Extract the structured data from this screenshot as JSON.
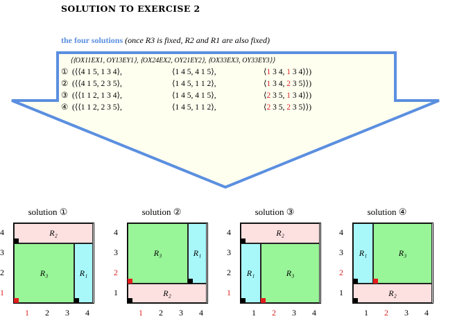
{
  "title": "SOLUTION TO EXERCISE 2",
  "subtitle": {
    "bold": "the four solutions",
    "italic": "(once R3 is fixed, R2 and R1 are also fixed)"
  },
  "header": "⟨⟨OX11EX1, OY13EY1⟩, ⟨OX24EX2, OY21EY2⟩, ⟨OX33EX3, OY33EY3⟩⟩",
  "rows": [
    {
      "num": "①",
      "r1": "(⟨⟨4 1 5, 1 3 4⟩,",
      "r2": "⟨1 4 5, 4 1 5⟩,",
      "r3a": "1",
      "r3b": " 3 4, ",
      "r3c": "1",
      "r3d": " 3 4⟩⟩)"
    },
    {
      "num": "②",
      "r1": "(⟨⟨4 1 5, 2 3 5⟩,",
      "r2": "⟨1 4 5, 1 1 2⟩,",
      "r3a": "1",
      "r3b": " 3 4, ",
      "r3c": "2",
      "r3d": " 3 5⟩⟩)"
    },
    {
      "num": "③",
      "r1": "(⟨⟨1 1 2, 1 3 4⟩,",
      "r2": "⟨1 4 5, 4 1 5⟩,",
      "r3a": "2",
      "r3b": " 3 5, ",
      "r3c": "1",
      "r3d": " 3 4⟩⟩)"
    },
    {
      "num": "④",
      "r1": "(⟨⟨1 1 2, 2 3 5⟩,",
      "r2": "⟨1 4 5, 1 1 2⟩,",
      "r3a": "2",
      "r3b": " 3 5, ",
      "r3c": "2",
      "r3d": " 3 5⟩⟩)"
    }
  ],
  "solutions": [
    {
      "title": "solution ①",
      "ylabels": [
        "4",
        "3",
        "2",
        "1"
      ],
      "xlabels": [
        "1",
        "2",
        "3",
        "4"
      ],
      "ylabel_red": "1",
      "xlabel_red": "1",
      "rects": [
        {
          "label": "R₂"
        },
        {
          "label": "R₃"
        },
        {
          "label": "R₁"
        }
      ]
    },
    {
      "title": "solution ②",
      "ylabels": [
        "4",
        "3",
        "2",
        "1"
      ],
      "xlabels": [
        "1",
        "2",
        "3",
        "4"
      ],
      "ylabel_red": "2",
      "xlabel_red": "1",
      "rects": [
        {
          "label": "R₃"
        },
        {
          "label": "R₁"
        },
        {
          "label": "R₂"
        }
      ]
    },
    {
      "title": "solution ③",
      "ylabels": [
        "4",
        "3",
        "2",
        "1"
      ],
      "xlabels": [
        "1",
        "2",
        "3",
        "4"
      ],
      "ylabel_red": "1",
      "xlabel_red": "2",
      "rects": [
        {
          "label": "R₂"
        },
        {
          "label": "R₁"
        },
        {
          "label": "R₃"
        }
      ]
    },
    {
      "title": "solution ④",
      "ylabels": [
        "4",
        "3",
        "2",
        "1"
      ],
      "xlabels": [
        "1",
        "2",
        "3",
        "4"
      ],
      "ylabel_red": "2",
      "xlabel_red": "2",
      "rects": [
        {
          "label": "R₁"
        },
        {
          "label": "R₃"
        },
        {
          "label": "R₂"
        }
      ]
    }
  ],
  "colors": {
    "arrow_border": "#5b8fe0",
    "arrow_fill": "#fffff0",
    "pink": "#fde0e0",
    "green": "#98f598",
    "cyan": "#a8f8fa",
    "red": "#dd2222"
  }
}
